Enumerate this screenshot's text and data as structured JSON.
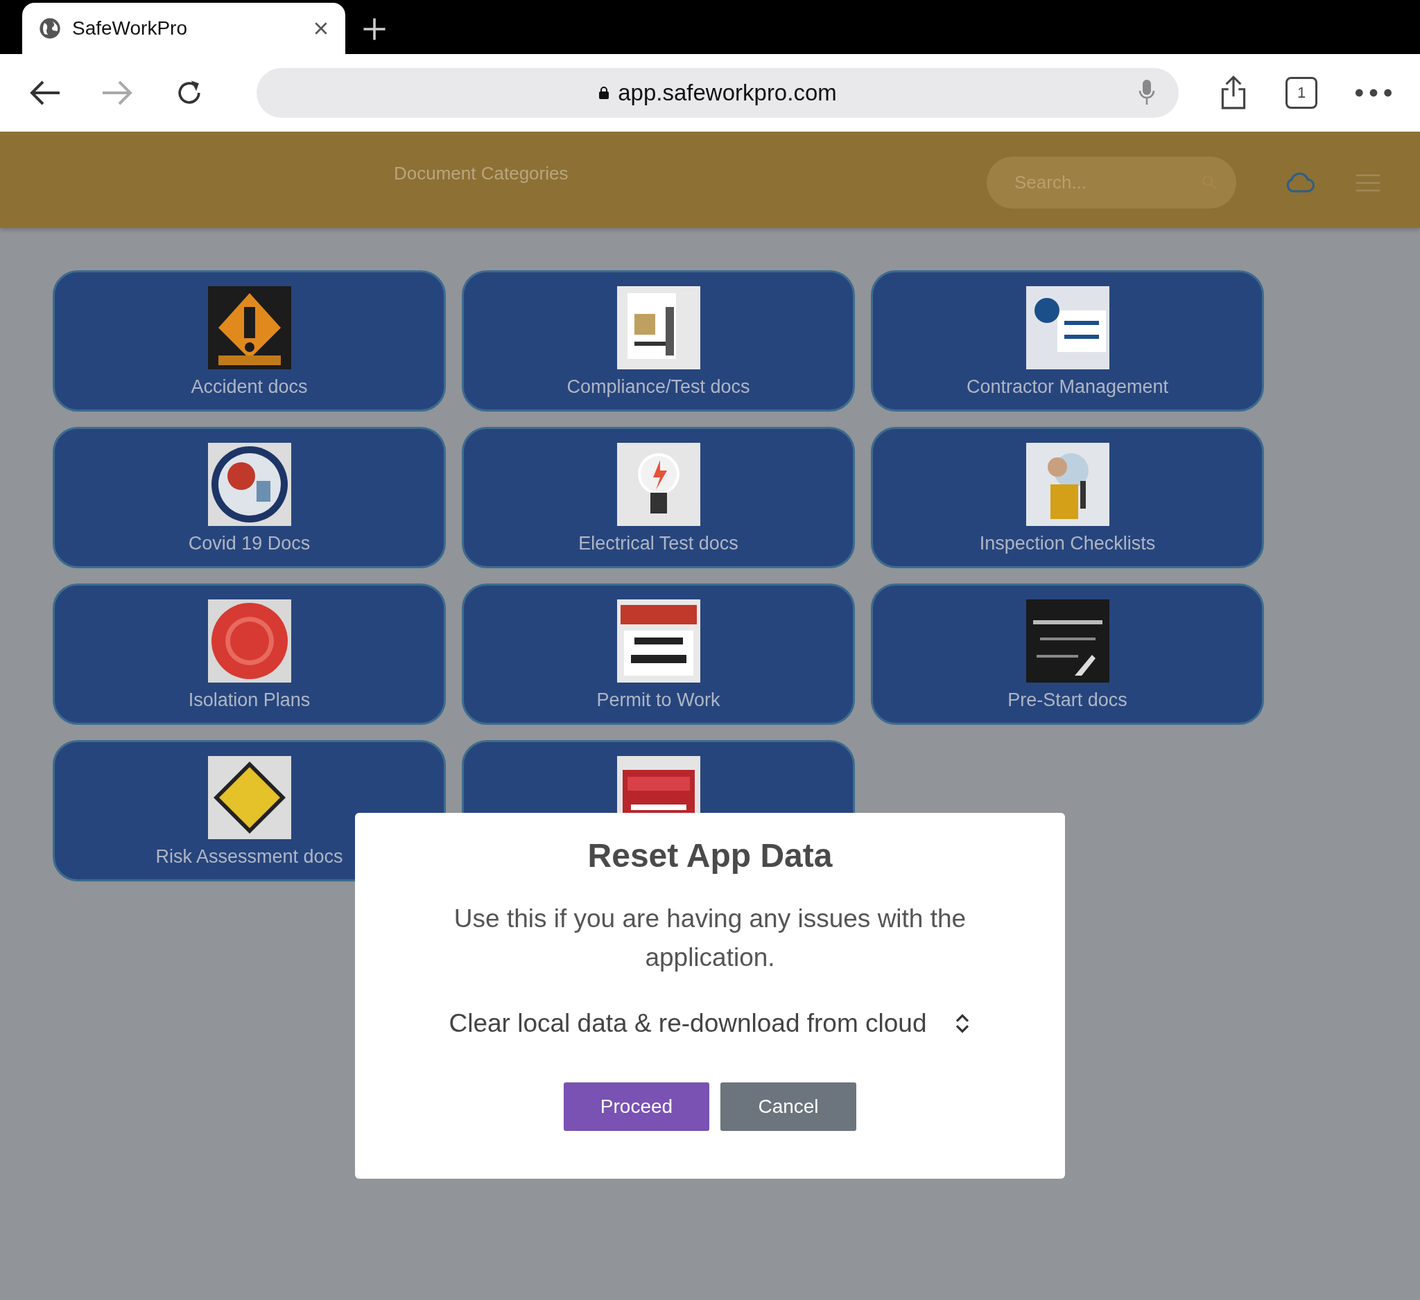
{
  "browser": {
    "tab_title": "SafeWorkPro",
    "url": "app.safeworkpro.com",
    "tab_count": "1"
  },
  "header": {
    "title": "Document Categories",
    "search": {
      "placeholder": "Search..."
    }
  },
  "categories": [
    {
      "image": {
        "kind": "picture"
      },
      "label": "Accident docs"
    },
    {
      "image": {
        "kind": "picture"
      },
      "label": "Compliance/Test docs"
    },
    {
      "image": {
        "kind": "picture"
      },
      "label": "Contractor Management"
    },
    {
      "image": {
        "kind": "picture"
      },
      "label": "Covid 19 Docs"
    },
    {
      "image": {
        "kind": "picture"
      },
      "label": "Electrical Test docs"
    },
    {
      "image": {
        "kind": "picture"
      },
      "label": "Inspection Checklists"
    },
    {
      "image": {
        "kind": "picture"
      },
      "label": "Isolation Plans"
    },
    {
      "image": {
        "kind": "picture"
      },
      "label": "Permit to Work"
    },
    {
      "image": {
        "kind": "picture"
      },
      "label": "Pre-Start docs"
    },
    {
      "image": {
        "kind": "picture"
      },
      "label": "Risk Assessment docs"
    },
    {
      "image": {
        "kind": "picture"
      }
    }
  ],
  "dialog": {
    "title": "Reset App Data",
    "message": "Use this if you are having any issues with the application.",
    "option": "Clear local data & re-download from cloud",
    "buttons": [
      {
        "label": "Proceed",
        "kind": "primary"
      },
      {
        "label": "Cancel",
        "kind": "secondary"
      }
    ]
  }
}
